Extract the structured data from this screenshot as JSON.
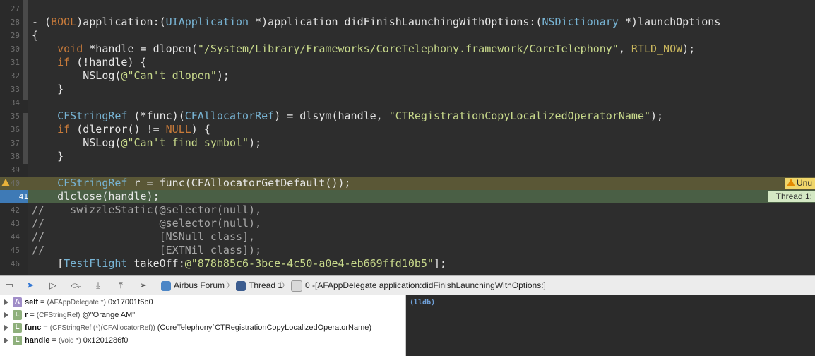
{
  "editor": {
    "lines": [
      {
        "n": "27",
        "code": ""
      },
      {
        "n": "28",
        "code": "- (BOOL)application:(UIApplication *)application didFinishLaunchingWithOptions:(NSDictionary *)launchOptions"
      },
      {
        "n": "29",
        "code": "{"
      },
      {
        "n": "30",
        "code": "    void *handle = dlopen(\"/System/Library/Frameworks/CoreTelephony.framework/CoreTelephony\", RTLD_NOW);"
      },
      {
        "n": "31",
        "code": "    if (!handle) {"
      },
      {
        "n": "32",
        "code": "        NSLog(@\"Can't dlopen\");"
      },
      {
        "n": "33",
        "code": "    }"
      },
      {
        "n": "34",
        "code": ""
      },
      {
        "n": "35",
        "code": "    CFStringRef (*func)(CFAllocatorRef) = dlsym(handle, \"CTRegistrationCopyLocalizedOperatorName\");"
      },
      {
        "n": "36",
        "code": "    if (dlerror() != NULL) {"
      },
      {
        "n": "37",
        "code": "        NSLog(@\"Can't find symbol\");"
      },
      {
        "n": "38",
        "code": "    }"
      },
      {
        "n": "39",
        "code": ""
      },
      {
        "n": "40",
        "code": "    CFStringRef r = func(CFAllocatorGetDefault());"
      },
      {
        "n": "41",
        "code": "    dlclose(handle);"
      },
      {
        "n": "42",
        "code": "//    swizzleStatic(@selector(null),"
      },
      {
        "n": "43",
        "code": "//                  @selector(null),"
      },
      {
        "n": "44",
        "code": "//                  [NSNull class],"
      },
      {
        "n": "45",
        "code": "//                  [EXTNil class]);"
      },
      {
        "n": "46",
        "code": "    [TestFlight takeOff:@\"878b85c6-3bce-4c50-a0e4-eb669ffd10b5\"];"
      }
    ],
    "warning_badge": "Unu",
    "thread_badge": "Thread 1:"
  },
  "debugbar": {
    "crumbs": {
      "app": "Airbus Forum",
      "thread": "Thread 1",
      "frame": "0 -[AFAppDelegate application:didFinishLaunchingWithOptions:]"
    }
  },
  "variables": [
    {
      "kind": "A",
      "name": "self",
      "type": "(AFAppDelegate *)",
      "value": "0x17001f6b0"
    },
    {
      "kind": "L",
      "name": "r",
      "type": "(CFStringRef)",
      "value": "@\"Orange AM\""
    },
    {
      "kind": "L",
      "name": "func",
      "type": "(CFStringRef (*)(CFAllocatorRef))",
      "value": "(CoreTelephony`CTRegistrationCopyLocalizedOperatorName)"
    },
    {
      "kind": "L",
      "name": "handle",
      "type": "(void *)",
      "value": "0x1201286f0"
    }
  ],
  "console": {
    "prompt": "(lldb)"
  },
  "colors": {
    "accent": "#3e7ab6",
    "warning": "#f0d66a",
    "pc_line": "#4a5f45",
    "warn_line": "#5a5736"
  }
}
